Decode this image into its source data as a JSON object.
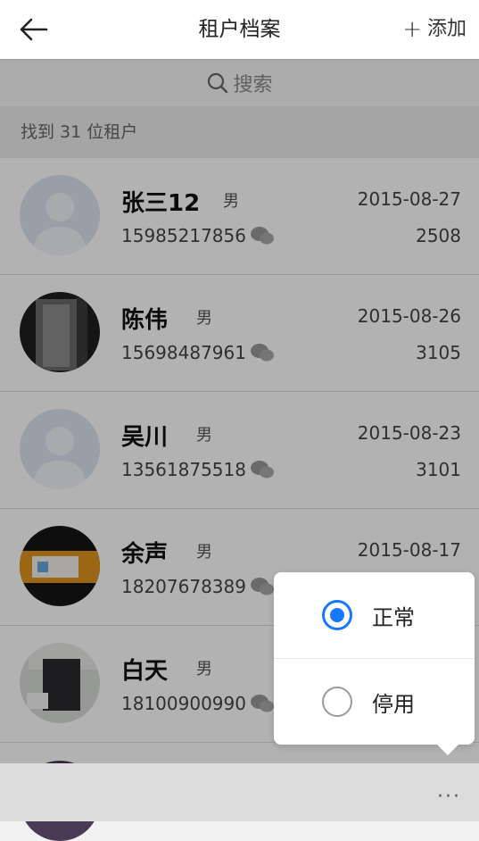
{
  "header": {
    "title": "租户档案",
    "add_label": "添加"
  },
  "search": {
    "placeholder": "搜索"
  },
  "summary": "找到 31 位租户",
  "tenants": [
    {
      "name": "张三12",
      "gender": "男",
      "phone": "15985217856",
      "date": "2015-08-27",
      "room": "2508",
      "avatar": "default"
    },
    {
      "name": "陈伟",
      "gender": "男",
      "phone": "15698487961",
      "date": "2015-08-26",
      "room": "3105",
      "avatar": "photo-dark"
    },
    {
      "name": "吴川",
      "gender": "男",
      "phone": "13561875518",
      "date": "2015-08-23",
      "room": "3101",
      "avatar": "default"
    },
    {
      "name": "余声",
      "gender": "男",
      "phone": "18207678389",
      "date": "2015-08-17",
      "room": "",
      "avatar": "photo-screen"
    },
    {
      "name": "白天",
      "gender": "男",
      "phone": "18100900990",
      "date": "",
      "room": "",
      "avatar": "photo-pc"
    }
  ],
  "status_menu": {
    "options": [
      {
        "label": "正常",
        "selected": true
      },
      {
        "label": "停用",
        "selected": false
      }
    ],
    "accent": "#1677ff"
  },
  "more_label": "···"
}
